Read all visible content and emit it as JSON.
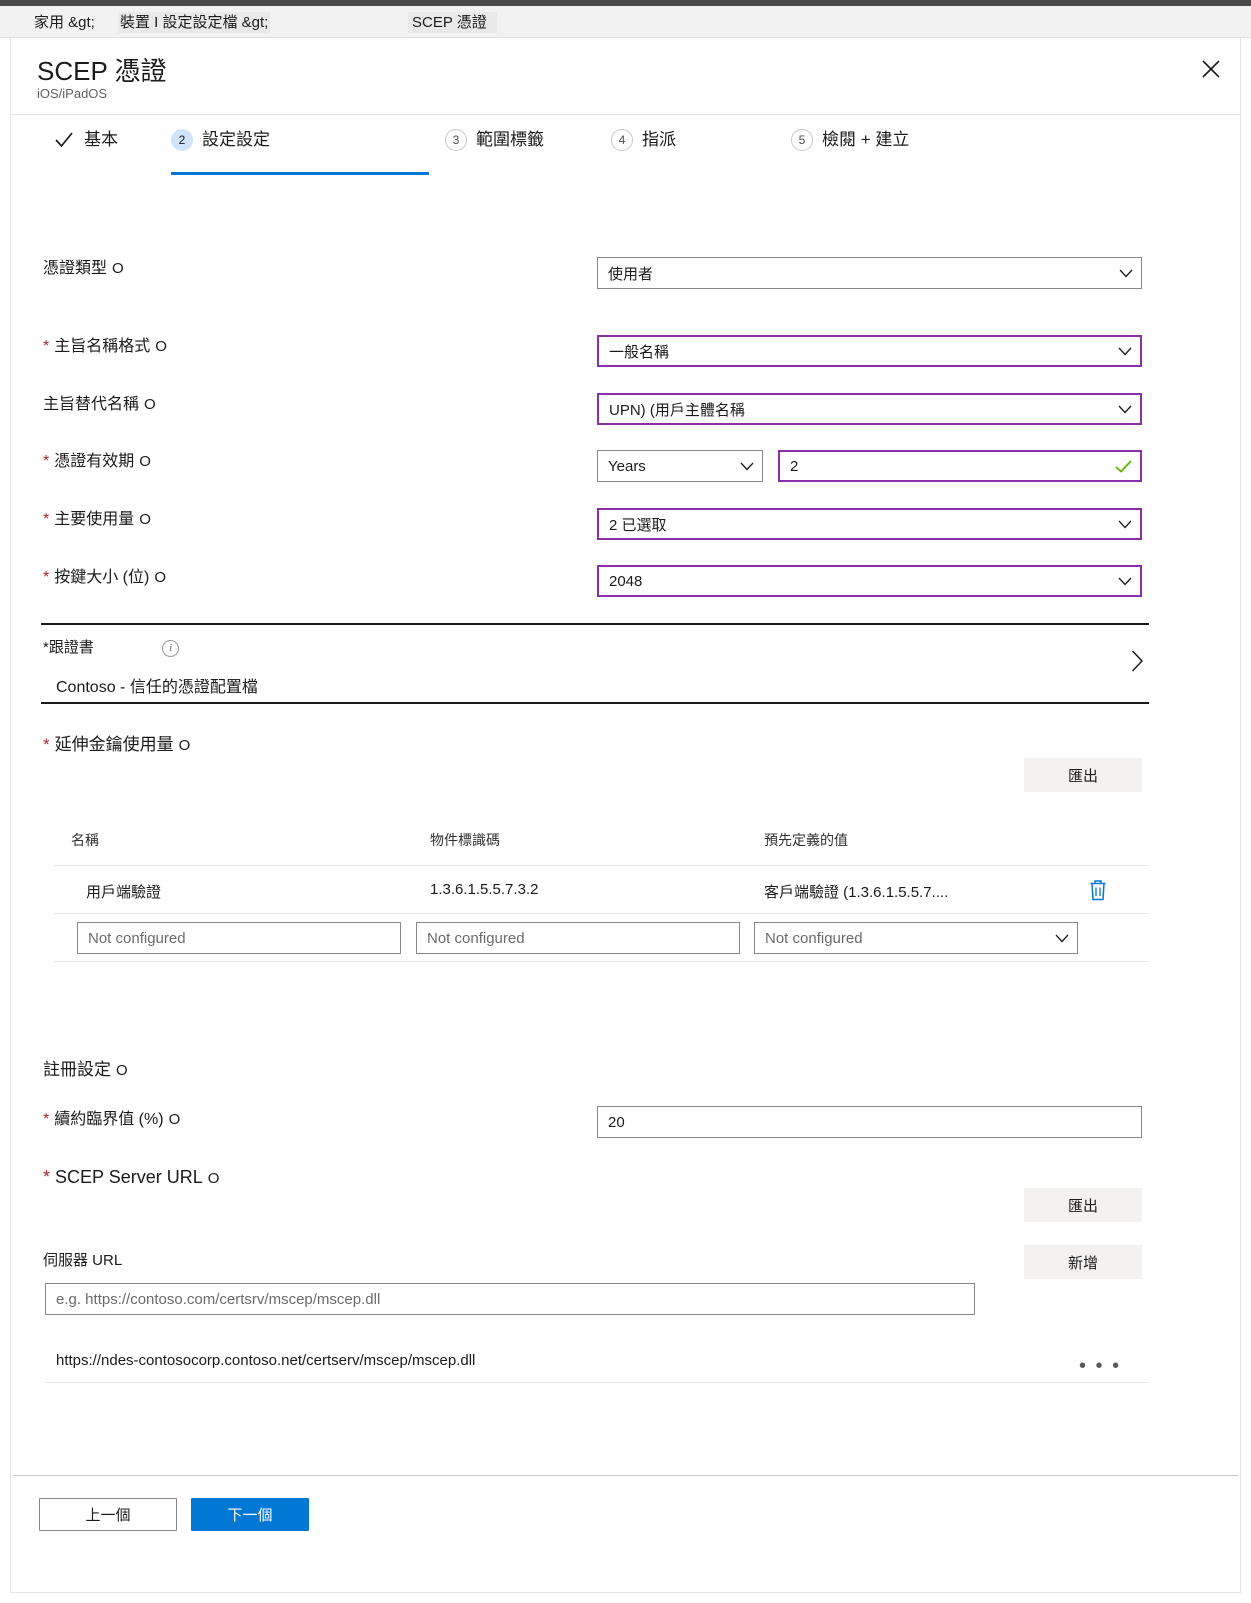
{
  "breadcrumb": {
    "crumb1": "家用 &gt;",
    "crumb2": "裝置 I 設定設定檔 &gt;",
    "crumb3": "SCEP 憑證"
  },
  "blade": {
    "title": "SCEP 憑證",
    "subtitle": "iOS/iPadOS",
    "close_icon": "close-icon"
  },
  "wizard": {
    "tabs": [
      {
        "marker": "✓",
        "label": "基本",
        "state": "complete"
      },
      {
        "marker": "2",
        "label": "設定設定",
        "state": "active"
      },
      {
        "marker": "3",
        "label": "範圍標籤",
        "state": "pending"
      },
      {
        "marker": "4",
        "label": "指派",
        "state": "pending"
      },
      {
        "marker": "5",
        "label": "檢閱 + 建立",
        "state": "pending"
      }
    ]
  },
  "form": {
    "certificate_type": {
      "label": "憑證類型",
      "required": false,
      "value": "使用者"
    },
    "subject_name_format": {
      "label": "主旨名稱格式",
      "required": true,
      "value": "一般名稱"
    },
    "subject_alternative_name": {
      "label": "主旨替代名稱",
      "required": false,
      "value": "UPN) (用戶主體名稱"
    },
    "certificate_validity_period": {
      "label": "憑證有效期",
      "required": true,
      "unit_value": "Years",
      "amount_value": "2",
      "valid_icon": "checkmark-icon"
    },
    "key_usage": {
      "label": "主要使用量",
      "required": true,
      "value": "2 已選取"
    },
    "key_size": {
      "label": "按鍵大小 (位)",
      "required": true,
      "value": "2048"
    }
  },
  "root_certificate": {
    "label": "*跟證書",
    "info_icon": "info-icon",
    "value": "Contoso - 信任的憑證配置檔",
    "chevron_icon": "chevron-right-icon"
  },
  "extended_key_usage": {
    "label": "延伸金鑰使用量",
    "required": true,
    "export_button": "匯出",
    "columns": [
      "名稱",
      "物件標識碼",
      "預先定義的值"
    ],
    "rows": [
      {
        "name": "用戶端驗證",
        "oid": "1.3.6.1.5.5.7.3.2",
        "predefined": "客戶端驗證 (1.3.6.1.5.5.7....",
        "delete_icon": "trash-icon"
      }
    ],
    "new_row": {
      "name_placeholder": "Not configured",
      "oid_placeholder": "Not configured",
      "predefined_placeholder": "Not configured"
    }
  },
  "enrollment_settings": {
    "label": "註冊設定",
    "renewal_threshold": {
      "label": "續約臨界值 (%)",
      "required": true,
      "value": "20"
    }
  },
  "scep_server_url": {
    "label": "SCEP Server URL",
    "required": true,
    "export_button": "匯出",
    "add_button": "新增",
    "server_url_label": "伺服器 URL",
    "server_url_placeholder": "e.g. https://contoso.com/certsrv/mscep/mscep.dll",
    "server_url_value": "",
    "urls": [
      {
        "url": "https://ndes-contosocorp.contoso.net/certserv/mscep/mscep.dll",
        "menu_icon": "ellipsis-icon"
      }
    ]
  },
  "footer": {
    "previous_button": "上一個",
    "next_button": "下一個"
  },
  "colors": {
    "accent": "#0078d4",
    "focus_border": "#8b2fa8",
    "required_asterisk": "#a4262c",
    "valid_check": "#5db300",
    "toolbar_button_bg": "#f3f2f1"
  }
}
